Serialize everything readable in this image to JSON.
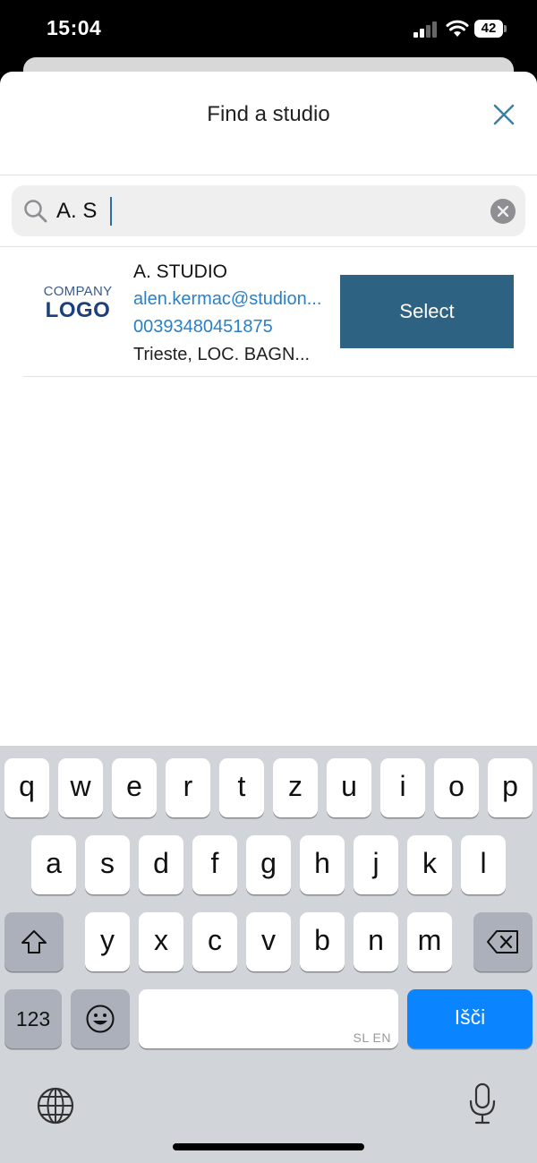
{
  "status_bar": {
    "time": "15:04",
    "battery": "42"
  },
  "sheet": {
    "title": "Find a studio"
  },
  "search": {
    "value": "A. S",
    "placeholder": ""
  },
  "result": {
    "logo_top": "COMPANY",
    "logo_bottom": "LOGO",
    "name": "A. STUDIO",
    "email": "alen.kermac@studion...",
    "phone": "00393480451875",
    "address": "Trieste, LOC. BAGN...",
    "select_label": "Select"
  },
  "keyboard": {
    "row1": [
      "q",
      "w",
      "e",
      "r",
      "t",
      "z",
      "u",
      "i",
      "o",
      "p"
    ],
    "row2": [
      "a",
      "s",
      "d",
      "f",
      "g",
      "h",
      "j",
      "k",
      "l"
    ],
    "row3": [
      "y",
      "x",
      "c",
      "v",
      "b",
      "n",
      "m"
    ],
    "numbers_label": "123",
    "space_lang": "SL EN",
    "go_label": "Išči"
  },
  "colors": {
    "accent_button": "#2d6282",
    "link": "#2a80c8",
    "go_key": "#0a84ff"
  }
}
